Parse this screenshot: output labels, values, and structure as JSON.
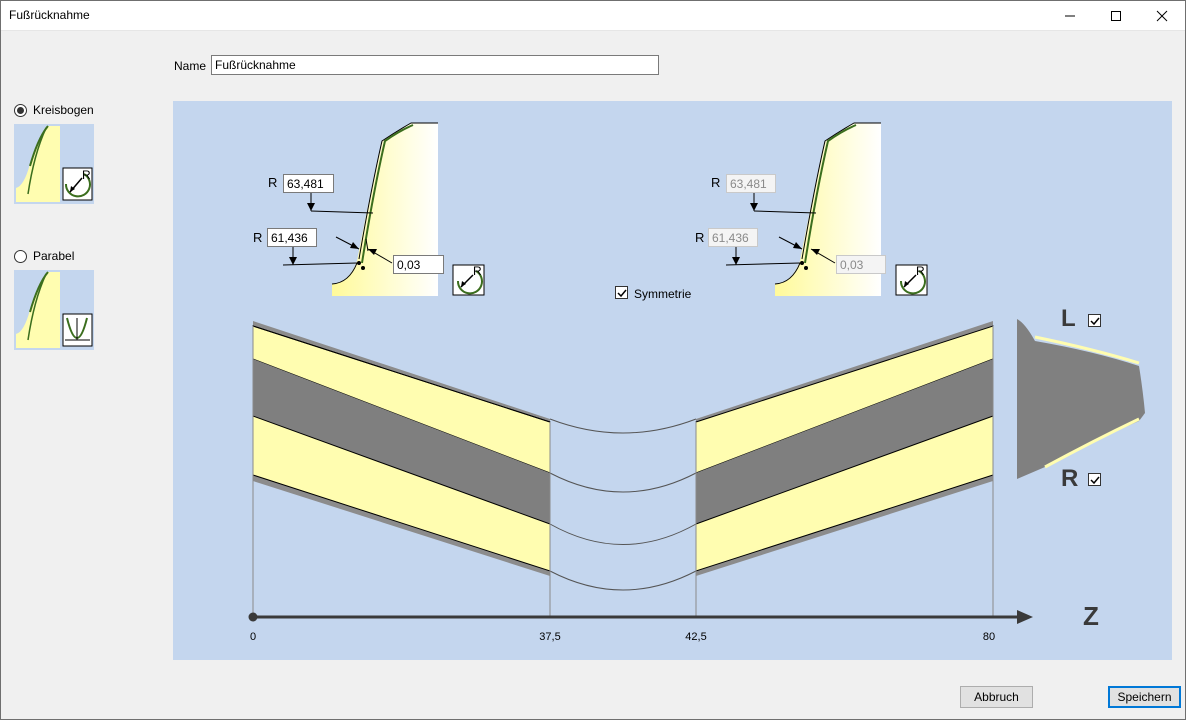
{
  "window": {
    "title": "Fußrücknahme"
  },
  "name_field": {
    "label": "Name",
    "value": "Fußrücknahme"
  },
  "profile_options": [
    {
      "label": "Kreisbogen",
      "selected": true
    },
    {
      "label": "Parabel",
      "selected": false
    }
  ],
  "left_diagram": {
    "r_label_top": "R",
    "r_top": "63,481",
    "r_label_bottom": "R",
    "r_bottom": "61,436",
    "offset": "0,03",
    "icon_letter": "R"
  },
  "right_diagram": {
    "r_label_top": "R",
    "r_top": "63,481",
    "r_label_bottom": "R",
    "r_bottom": "61,436",
    "offset": "0,03",
    "icon_letter": "R",
    "disabled": true
  },
  "symmetry": {
    "label": "Symmetrie",
    "checked": true
  },
  "side_toggles": [
    {
      "label": "L",
      "checked": true
    },
    {
      "label": "R",
      "checked": true
    }
  ],
  "axis": {
    "label": "Z",
    "ticks": [
      "0",
      "37,5",
      "42,5",
      "80"
    ]
  },
  "buttons": {
    "cancel": "Abbruch",
    "save": "Speichern"
  },
  "colors": {
    "canvas": "#c4d6ee",
    "profile_fill": "#fffdb0",
    "band_gray": "#7f7f7f",
    "accent": "#0078d7"
  }
}
